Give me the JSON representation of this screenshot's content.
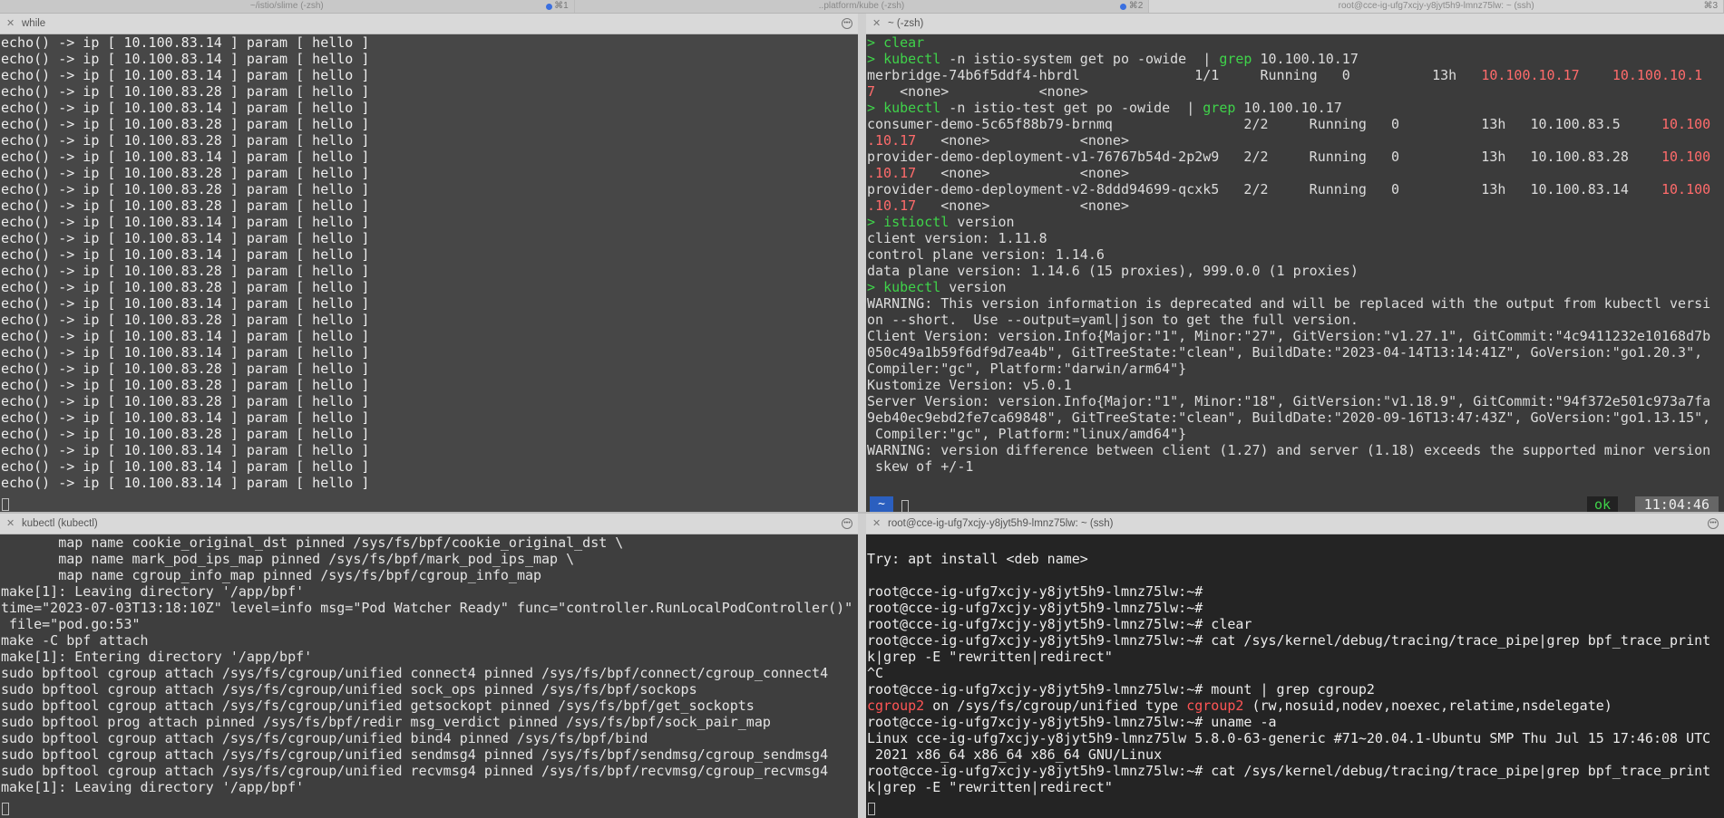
{
  "tabs": [
    {
      "title": "~/istio/slime (-zsh)",
      "shortcut": "⌘1",
      "dot": true
    },
    {
      "title": "..platform/kube (-zsh)",
      "shortcut": "⌘2",
      "dot": true
    },
    {
      "title": "root@cce-ig-ufg7xcjy-y8jyt5h9-lmnz75lw: ~ (ssh)",
      "shortcut": "⌘3",
      "dot": false
    }
  ],
  "panes": {
    "top_left": {
      "title": "while",
      "lines": [
        "echo() -> ip [ 10.100.83.14 ] param [ hello ]",
        "echo() -> ip [ 10.100.83.14 ] param [ hello ]",
        "echo() -> ip [ 10.100.83.14 ] param [ hello ]",
        "echo() -> ip [ 10.100.83.28 ] param [ hello ]",
        "echo() -> ip [ 10.100.83.14 ] param [ hello ]",
        "echo() -> ip [ 10.100.83.28 ] param [ hello ]",
        "echo() -> ip [ 10.100.83.28 ] param [ hello ]",
        "echo() -> ip [ 10.100.83.14 ] param [ hello ]",
        "echo() -> ip [ 10.100.83.28 ] param [ hello ]",
        "echo() -> ip [ 10.100.83.28 ] param [ hello ]",
        "echo() -> ip [ 10.100.83.28 ] param [ hello ]",
        "echo() -> ip [ 10.100.83.14 ] param [ hello ]",
        "echo() -> ip [ 10.100.83.14 ] param [ hello ]",
        "echo() -> ip [ 10.100.83.14 ] param [ hello ]",
        "echo() -> ip [ 10.100.83.28 ] param [ hello ]",
        "echo() -> ip [ 10.100.83.28 ] param [ hello ]",
        "echo() -> ip [ 10.100.83.14 ] param [ hello ]",
        "echo() -> ip [ 10.100.83.28 ] param [ hello ]",
        "echo() -> ip [ 10.100.83.14 ] param [ hello ]",
        "echo() -> ip [ 10.100.83.14 ] param [ hello ]",
        "echo() -> ip [ 10.100.83.28 ] param [ hello ]",
        "echo() -> ip [ 10.100.83.28 ] param [ hello ]",
        "echo() -> ip [ 10.100.83.28 ] param [ hello ]",
        "echo() -> ip [ 10.100.83.14 ] param [ hello ]",
        "echo() -> ip [ 10.100.83.28 ] param [ hello ]",
        "echo() -> ip [ 10.100.83.14 ] param [ hello ]",
        "echo() -> ip [ 10.100.83.14 ] param [ hello ]",
        "echo() -> ip [ 10.100.83.14 ] param [ hello ]"
      ]
    },
    "top_right": {
      "title": "~ (-zsh)",
      "status_home": "~",
      "status_ok": "ok",
      "status_time": "11:04:46",
      "lines": [
        {
          "segs": [
            {
              "t": "> ",
              "c": "prompt-g"
            },
            {
              "t": "clear",
              "c": "prompt-g"
            }
          ]
        },
        {
          "segs": [
            {
              "t": "> ",
              "c": "prompt-g"
            },
            {
              "t": "kubectl",
              "c": "prompt-g"
            },
            {
              "t": " -n istio-system get po -owide  | "
            },
            {
              "t": "grep",
              "c": "grep-g"
            },
            {
              "t": " 10.100.10.17"
            }
          ]
        },
        {
          "segs": [
            {
              "t": "merbridge-74b6f5ddf4-hbrdl              1/1     Running   0          13h   "
            },
            {
              "t": "10.100.10.17",
              "c": "hl-red"
            },
            {
              "t": "    "
            },
            {
              "t": "10.100.10.1",
              "c": "hl-red"
            }
          ]
        },
        {
          "segs": [
            {
              "t": "7",
              "c": "hl-red"
            },
            {
              "t": "   <none>           <none>"
            }
          ]
        },
        {
          "segs": [
            {
              "t": "> ",
              "c": "prompt-g"
            },
            {
              "t": "kubectl",
              "c": "prompt-g"
            },
            {
              "t": " -n istio-test get po -owide  | "
            },
            {
              "t": "grep",
              "c": "grep-g"
            },
            {
              "t": " 10.100.10.17"
            }
          ]
        },
        {
          "segs": [
            {
              "t": "consumer-demo-5c65f88b79-brnmq                2/2     Running   0          13h   10.100.83.5     "
            },
            {
              "t": "10.100",
              "c": "hl-red"
            }
          ]
        },
        {
          "segs": [
            {
              "t": ".10.17",
              "c": "hl-red"
            },
            {
              "t": "   <none>           <none>"
            }
          ]
        },
        {
          "segs": [
            {
              "t": "provider-demo-deployment-v1-76767b54d-2p2w9   2/2     Running   0          13h   10.100.83.28    "
            },
            {
              "t": "10.100",
              "c": "hl-red"
            }
          ]
        },
        {
          "segs": [
            {
              "t": ".10.17",
              "c": "hl-red"
            },
            {
              "t": "   <none>           <none>"
            }
          ]
        },
        {
          "segs": [
            {
              "t": "provider-demo-deployment-v2-8ddd94699-qcxk5   2/2     Running   0          13h   10.100.83.14    "
            },
            {
              "t": "10.100",
              "c": "hl-red"
            }
          ]
        },
        {
          "segs": [
            {
              "t": ".10.17",
              "c": "hl-red"
            },
            {
              "t": "   <none>           <none>"
            }
          ]
        },
        {
          "segs": [
            {
              "t": "> ",
              "c": "prompt-g"
            },
            {
              "t": "istioctl",
              "c": "prompt-g"
            },
            {
              "t": " version"
            }
          ]
        },
        {
          "segs": [
            {
              "t": "client version: 1.11.8"
            }
          ]
        },
        {
          "segs": [
            {
              "t": "control plane version: 1.14.6"
            }
          ]
        },
        {
          "segs": [
            {
              "t": "data plane version: 1.14.6 (15 proxies), 999.0.0 (1 proxies)"
            }
          ]
        },
        {
          "segs": [
            {
              "t": "> ",
              "c": "prompt-g"
            },
            {
              "t": "kubectl",
              "c": "prompt-g"
            },
            {
              "t": " version"
            }
          ]
        },
        {
          "segs": [
            {
              "t": "WARNING: This version information is deprecated and will be replaced with the output from kubectl versi"
            }
          ]
        },
        {
          "segs": [
            {
              "t": "on --short.  Use --output=yaml|json to get the full version."
            }
          ]
        },
        {
          "segs": [
            {
              "t": "Client Version: version.Info{Major:\"1\", Minor:\"27\", GitVersion:\"v1.27.1\", GitCommit:\"4c9411232e10168d7b"
            }
          ]
        },
        {
          "segs": [
            {
              "t": "050c49a1b59f6df9d7ea4b\", GitTreeState:\"clean\", BuildDate:\"2023-04-14T13:14:41Z\", GoVersion:\"go1.20.3\","
            }
          ]
        },
        {
          "segs": [
            {
              "t": "Compiler:\"gc\", Platform:\"darwin/arm64\"}"
            }
          ]
        },
        {
          "segs": [
            {
              "t": "Kustomize Version: v5.0.1"
            }
          ]
        },
        {
          "segs": [
            {
              "t": "Server Version: version.Info{Major:\"1\", Minor:\"18\", GitVersion:\"v1.18.9\", GitCommit:\"94f372e501c973a7fa"
            }
          ]
        },
        {
          "segs": [
            {
              "t": "9eb40ec9ebd2fe7ca69848\", GitTreeState:\"clean\", BuildDate:\"2020-09-16T13:47:43Z\", GoVersion:\"go1.13.15\","
            }
          ]
        },
        {
          "segs": [
            {
              "t": " Compiler:\"gc\", Platform:\"linux/amd64\"}"
            }
          ]
        },
        {
          "segs": [
            {
              "t": "WARNING: version difference between client (1.27) and server (1.18) exceeds the supported minor version"
            }
          ]
        },
        {
          "segs": [
            {
              "t": " skew of +/-1"
            }
          ]
        }
      ]
    },
    "bottom_left": {
      "title": "kubectl (kubectl)",
      "lines": [
        "       map name cookie_original_dst pinned /sys/fs/bpf/cookie_original_dst \\",
        "       map name mark_pod_ips_map pinned /sys/fs/bpf/mark_pod_ips_map \\",
        "       map name cgroup_info_map pinned /sys/fs/bpf/cgroup_info_map",
        "make[1]: Leaving directory '/app/bpf'",
        "time=\"2023-07-03T13:18:10Z\" level=info msg=\"Pod Watcher Ready\" func=\"controller.RunLocalPodController()\"",
        " file=\"pod.go:53\"",
        "make -C bpf attach",
        "make[1]: Entering directory '/app/bpf'",
        "sudo bpftool cgroup attach /sys/fs/cgroup/unified connect4 pinned /sys/fs/bpf/connect/cgroup_connect4",
        "sudo bpftool cgroup attach /sys/fs/cgroup/unified sock_ops pinned /sys/fs/bpf/sockops",
        "sudo bpftool cgroup attach /sys/fs/cgroup/unified getsockopt pinned /sys/fs/bpf/get_sockopts",
        "sudo bpftool prog attach pinned /sys/fs/bpf/redir msg_verdict pinned /sys/fs/bpf/sock_pair_map",
        "sudo bpftool cgroup attach /sys/fs/cgroup/unified bind4 pinned /sys/fs/bpf/bind",
        "sudo bpftool cgroup attach /sys/fs/cgroup/unified sendmsg4 pinned /sys/fs/bpf/sendmsg/cgroup_sendmsg4",
        "sudo bpftool cgroup attach /sys/fs/cgroup/unified recvmsg4 pinned /sys/fs/bpf/recvmsg/cgroup_recvmsg4",
        "make[1]: Leaving directory '/app/bpf'"
      ]
    },
    "bottom_right": {
      "title": "root@cce-ig-ufg7xcjy-y8jyt5h9-lmnz75lw: ~ (ssh)",
      "lines": [
        {
          "segs": [
            {
              "t": ""
            }
          ]
        },
        {
          "segs": [
            {
              "t": "Try: apt install <deb name>"
            }
          ]
        },
        {
          "segs": [
            {
              "t": ""
            }
          ]
        },
        {
          "segs": [
            {
              "t": "root@cce-ig-ufg7xcjy-y8jyt5h9-lmnz75lw:~#"
            }
          ]
        },
        {
          "segs": [
            {
              "t": "root@cce-ig-ufg7xcjy-y8jyt5h9-lmnz75lw:~#"
            }
          ]
        },
        {
          "segs": [
            {
              "t": "root@cce-ig-ufg7xcjy-y8jyt5h9-lmnz75lw:~# clear"
            }
          ]
        },
        {
          "segs": [
            {
              "t": "root@cce-ig-ufg7xcjy-y8jyt5h9-lmnz75lw:~# cat /sys/kernel/debug/tracing/trace_pipe|grep bpf_trace_print"
            }
          ]
        },
        {
          "segs": [
            {
              "t": "k|grep -E \"rewritten|redirect\""
            }
          ]
        },
        {
          "segs": [
            {
              "t": "^C"
            }
          ]
        },
        {
          "segs": [
            {
              "t": "root@cce-ig-ufg7xcjy-y8jyt5h9-lmnz75lw:~# mount | grep cgroup2"
            }
          ]
        },
        {
          "segs": [
            {
              "t": "cgroup2",
              "c": "cgroup-red"
            },
            {
              "t": " on /sys/fs/cgroup/unified type "
            },
            {
              "t": "cgroup2",
              "c": "cgroup-red"
            },
            {
              "t": " (rw,nosuid,nodev,noexec,relatime,nsdelegate)"
            }
          ]
        },
        {
          "segs": [
            {
              "t": "root@cce-ig-ufg7xcjy-y8jyt5h9-lmnz75lw:~# uname -a"
            }
          ]
        },
        {
          "segs": [
            {
              "t": "Linux cce-ig-ufg7xcjy-y8jyt5h9-lmnz75lw 5.8.0-63-generic #71~20.04.1-Ubuntu SMP Thu Jul 15 17:46:08 UTC"
            }
          ]
        },
        {
          "segs": [
            {
              "t": " 2021 x86_64 x86_64 x86_64 GNU/Linux"
            }
          ]
        },
        {
          "segs": [
            {
              "t": "root@cce-ig-ufg7xcjy-y8jyt5h9-lmnz75lw:~# cat /sys/kernel/debug/tracing/trace_pipe|grep bpf_trace_print"
            }
          ]
        },
        {
          "segs": [
            {
              "t": "k|grep -E \"rewritten|redirect\""
            }
          ]
        }
      ]
    }
  },
  "colors": {
    "prompt_green": "#3fd34a",
    "highlight_red": "#ff6b6b",
    "status_blue": "#2b5fbf"
  }
}
